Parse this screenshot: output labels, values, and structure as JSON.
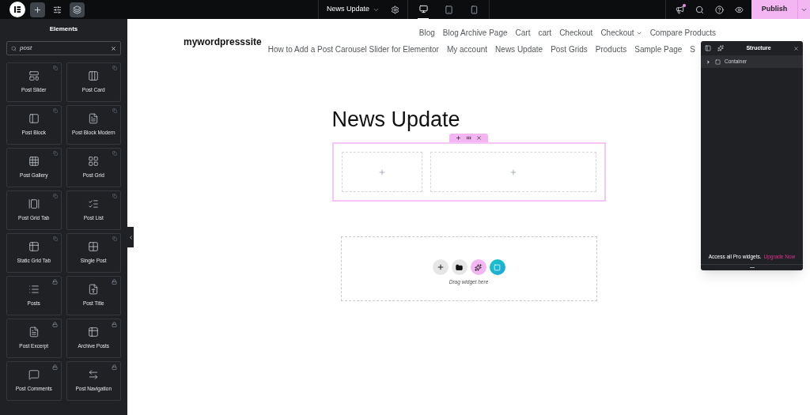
{
  "topbar": {
    "left_tools": [
      {
        "kind": "add",
        "selected": true
      },
      {
        "kind": "settings",
        "selected": false
      },
      {
        "kind": "layers",
        "selected": true
      }
    ],
    "page_title": "News Update",
    "devices": [
      {
        "kind": "desktop",
        "selected": true
      },
      {
        "kind": "tablet",
        "selected": false
      },
      {
        "kind": "mobile",
        "selected": false
      }
    ],
    "notification_dot": true,
    "publish": "Publish"
  },
  "sidebar": {
    "title": "Elements",
    "search": {
      "value": "post"
    },
    "widgets": [
      {
        "label": "Post Slider",
        "locked": false
      },
      {
        "label": "Post Card",
        "locked": false
      },
      {
        "label": "Post Block",
        "locked": false
      },
      {
        "label": "Post Block Modern",
        "locked": false
      },
      {
        "label": "Post Gallery",
        "locked": false
      },
      {
        "label": "Post Grid",
        "locked": false
      },
      {
        "label": "Post Grid Tab",
        "locked": false
      },
      {
        "label": "Post List",
        "locked": false
      },
      {
        "label": "Static Grid Tab",
        "locked": false
      },
      {
        "label": "Single Post",
        "locked": false
      },
      {
        "label": "Posts",
        "locked": true
      },
      {
        "label": "Post Title",
        "locked": true
      },
      {
        "label": "Post Excerpt",
        "locked": true
      },
      {
        "label": "Archive Posts",
        "locked": true
      },
      {
        "label": "Post Comments",
        "locked": true
      },
      {
        "label": "Post Navigation",
        "locked": true
      }
    ]
  },
  "site": {
    "title": "mywordpresssite",
    "menu_row_1": [
      {
        "label": "Blog",
        "dropdown": false
      },
      {
        "label": "Blog Archive Page",
        "dropdown": false
      },
      {
        "label": "Cart",
        "dropdown": false
      },
      {
        "label": "cart",
        "dropdown": false
      },
      {
        "label": "Checkout",
        "dropdown": false
      },
      {
        "label": "Checkout",
        "dropdown": true
      },
      {
        "label": "Compare Products",
        "dropdown": false
      }
    ],
    "menu_row_2": [
      {
        "label": "How to Add a Post Carousel Slider for Elementor",
        "dropdown": false
      },
      {
        "label": "My account",
        "dropdown": false
      },
      {
        "label": "News Update",
        "dropdown": false
      },
      {
        "label": "Post Grids",
        "dropdown": false
      },
      {
        "label": "Products",
        "dropdown": false
      },
      {
        "label": "Sample Page",
        "dropdown": false
      },
      {
        "label": "S",
        "dropdown": false
      }
    ]
  },
  "canvas": {
    "heading": "News Update",
    "container_columns": [
      {
        "kind": "narrow"
      },
      {
        "kind": "wide"
      }
    ],
    "drop_zone": {
      "hint": "Drag widget here"
    }
  },
  "structure": {
    "title": "Structure",
    "items": [
      {
        "label": "Container",
        "expanded": false
      }
    ],
    "promo": "Access all Pro widgets.",
    "upgrade_link": "Upgrade Now"
  }
}
